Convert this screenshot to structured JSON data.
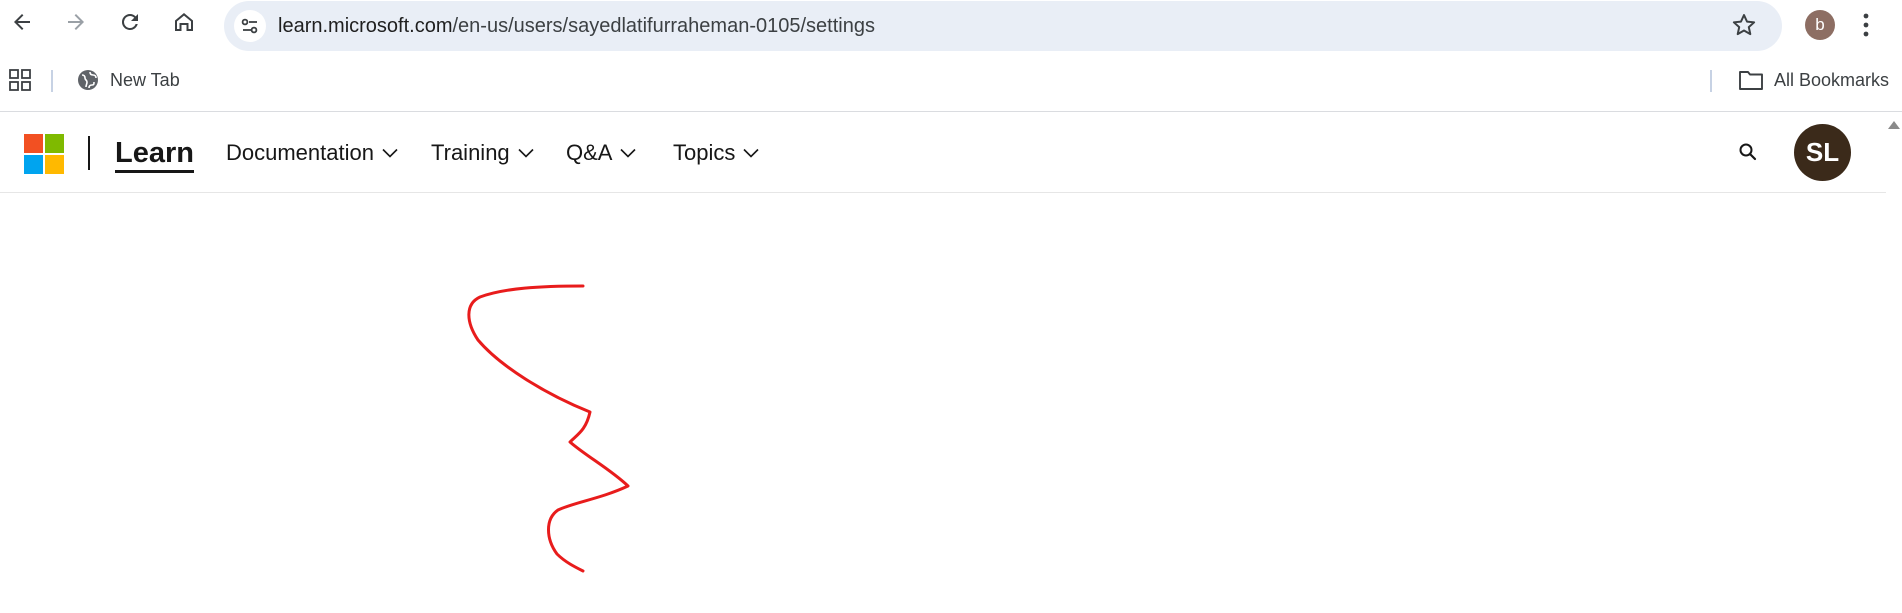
{
  "browser": {
    "url_host": "learn.microsoft.com",
    "url_path": "/en-us/users/sayedlatifurraheman-0105/settings",
    "profile_initial": "b",
    "profile_color": "#8d6e63",
    "omnibox_color": "#e9eef6",
    "icons": [
      "back-icon",
      "forward-icon",
      "reload-icon",
      "home-icon",
      "site-info-icon",
      "bookmark-star-icon",
      "kebab-menu-icon"
    ]
  },
  "bookmarks": {
    "items": [
      {
        "label": "New Tab",
        "icon": "globe-icon"
      }
    ],
    "all_bookmarks_label": "All Bookmarks"
  },
  "learn": {
    "brand": "Learn",
    "nav": [
      {
        "label": "Documentation"
      },
      {
        "label": "Training"
      },
      {
        "label": "Q&A"
      },
      {
        "label": "Topics"
      }
    ],
    "user_initials": "SL",
    "user_avatar_color": "#3b2a1a",
    "logo_colors": [
      "#f25022",
      "#7fba00",
      "#00a4ef",
      "#ffb900"
    ]
  },
  "annotation": {
    "color": "#e81c1c"
  }
}
